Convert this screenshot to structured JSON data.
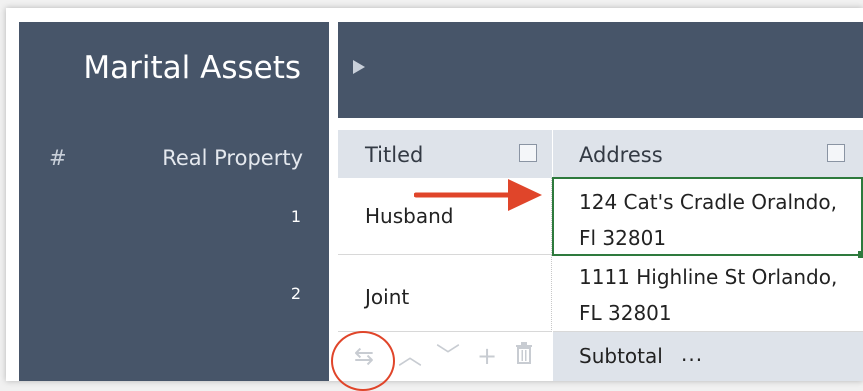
{
  "left_panel": {
    "title": "Marital Assets",
    "hash_header": "#",
    "column_header": "Real Property",
    "row_numbers": [
      "1",
      "2"
    ]
  },
  "table": {
    "headers": [
      {
        "label": "Titled",
        "checked": false
      },
      {
        "label": "Address",
        "checked": false
      }
    ],
    "rows": [
      {
        "titled": "Husband",
        "address_line1": "124 Cat's Cradle Oralndo,",
        "address_line2": "Fl 32801"
      },
      {
        "titled": "Joint",
        "address_line1": "1111 Highline St Orlando,",
        "address_line2": "FL 32801"
      }
    ],
    "subtotal_label": "Subtotal",
    "subtotal_menu": "..."
  },
  "toolbar": {
    "icons": [
      "swap-icon",
      "move-up-icon",
      "move-down-icon",
      "add-icon",
      "delete-icon"
    ],
    "swap_glyph": "⇆",
    "up_glyph": "︿",
    "down_glyph": "﹀",
    "add_glyph": "+",
    "delete_glyph": "🗑"
  },
  "colors": {
    "panel": "#475569",
    "header": "#dee3ea",
    "selection": "#2e7a3d",
    "annotation": "#e0452a"
  }
}
